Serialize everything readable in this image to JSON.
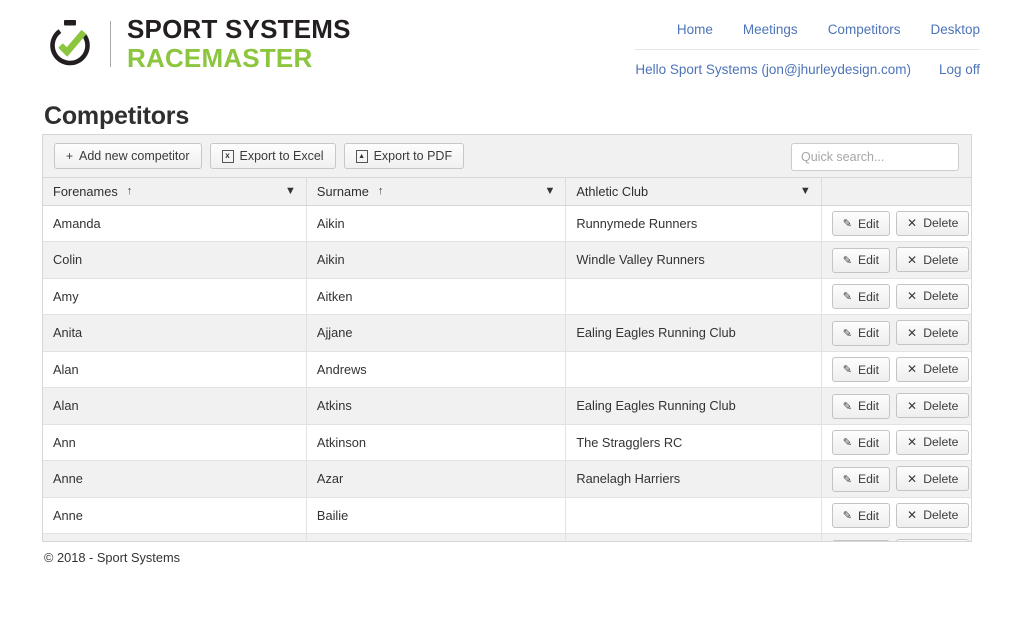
{
  "brand": {
    "line1": "SPORT SYSTEMS",
    "line2": "RACEMASTER",
    "logo_icon": "stopwatch-check-icon",
    "green": "#8cc63e",
    "dark": "#231f20"
  },
  "nav": {
    "primary": [
      {
        "label": "Home",
        "name": "nav-home"
      },
      {
        "label": "Meetings",
        "name": "nav-meetings"
      },
      {
        "label": "Competitors",
        "name": "nav-competitors"
      },
      {
        "label": "Desktop",
        "name": "nav-desktop"
      }
    ],
    "user_greeting": "Hello Sport Systems (jon@jhurleydesign.com)",
    "logoff": "Log off",
    "link_color": "#4d74b8"
  },
  "page": {
    "title": "Competitors"
  },
  "toolbar": {
    "add_label": "Add new competitor",
    "add_glyph": "+",
    "excel_label": "Export to Excel",
    "excel_glyph": "x",
    "pdf_label": "Export to PDF",
    "pdf_glyph": "ᴘ",
    "search_placeholder": "Quick search...",
    "search_value": ""
  },
  "table": {
    "columns": [
      {
        "label": "Forenames",
        "sort": "↑",
        "filter": true
      },
      {
        "label": "Surname",
        "sort": "↑",
        "filter": true
      },
      {
        "label": "Athletic Club",
        "sort": "",
        "filter": true
      },
      {
        "label": "",
        "sort": "",
        "filter": false
      }
    ],
    "row_actions": {
      "edit_label": "Edit",
      "delete_label": "Delete",
      "delete_glyph": "✕"
    },
    "rows": [
      {
        "forename": "Amanda",
        "surname": "Aikin",
        "club": "Runnymede Runners"
      },
      {
        "forename": "Colin",
        "surname": "Aikin",
        "club": "Windle Valley Runners"
      },
      {
        "forename": "Amy",
        "surname": "Aitken",
        "club": ""
      },
      {
        "forename": "Anita",
        "surname": "Ajjane",
        "club": "Ealing Eagles Running Club"
      },
      {
        "forename": "Alan",
        "surname": "Andrews",
        "club": ""
      },
      {
        "forename": "Alan",
        "surname": "Atkins",
        "club": "Ealing Eagles Running Club"
      },
      {
        "forename": "Ann",
        "surname": "Atkinson",
        "club": "The Stragglers RC"
      },
      {
        "forename": "Anne",
        "surname": "Azar",
        "club": "Ranelagh Harriers"
      },
      {
        "forename": "Anne",
        "surname": "Bailie",
        "club": ""
      },
      {
        "forename": "",
        "surname": "",
        "club": ""
      }
    ]
  },
  "footer": {
    "copyright": "© 2018 - Sport Systems"
  }
}
